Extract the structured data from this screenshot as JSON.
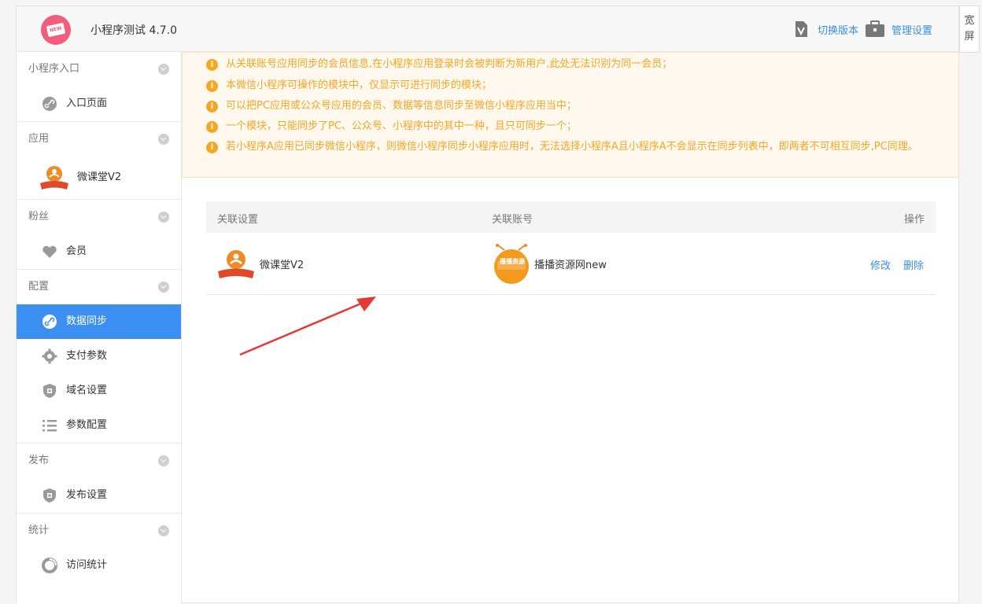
{
  "header": {
    "app_title": "小程序测试 4.7.0",
    "logo_text": "NEW",
    "switch_version": "切换版本",
    "manage_settings": "管理设置"
  },
  "side_tab": {
    "label": "宽屏"
  },
  "sidebar": {
    "groups": [
      {
        "title": "小程序入口",
        "items": [
          {
            "label": "入口页面",
            "icon": "link-icon"
          }
        ]
      },
      {
        "title": "应用",
        "items": [
          {
            "label": "微课堂V2",
            "icon": "app-logo"
          }
        ]
      },
      {
        "title": "粉丝",
        "items": [
          {
            "label": "会员",
            "icon": "heart-icon"
          }
        ]
      },
      {
        "title": "配置",
        "items": [
          {
            "label": "数据同步",
            "icon": "link-icon",
            "active": true
          },
          {
            "label": "支付参数",
            "icon": "gear-icon"
          },
          {
            "label": "域名设置",
            "icon": "shield-icon"
          },
          {
            "label": "参数配置",
            "icon": "list-icon"
          }
        ]
      },
      {
        "title": "发布",
        "items": [
          {
            "label": "发布设置",
            "icon": "shield-icon"
          }
        ]
      },
      {
        "title": "统计",
        "items": [
          {
            "label": "访问统计",
            "icon": "stats-icon"
          }
        ]
      }
    ]
  },
  "notice": {
    "lines": [
      "从关联账号应用同步的会员信息,在小程序应用登录时会被判断为新用户,此处无法识别为同一会员；",
      "本微信小程序可操作的模块中，仅显示可进行同步的模块；",
      "可以把PC应用或公众号应用的会员、数据等信息同步至微信小程序应用当中；",
      "一个模块，只能同步了PC、公众号、小程序中的其中一种，且只可同步一个；",
      "若小程序A应用已同步微信小程序，则微信小程序同步小程序应用时，无法选择小程序A且小程序A不会显示在同步列表中，即两者不可相互同步,PC同理。"
    ]
  },
  "table": {
    "headers": {
      "setting": "关联设置",
      "account": "关联账号",
      "action": "操作"
    },
    "rows": [
      {
        "setting": "微课堂V2",
        "account": "播播资源网new",
        "account_logo_text": "播播资源",
        "edit": "修改",
        "delete": "删除"
      }
    ]
  },
  "colors": {
    "accent": "#3b8ff0",
    "warning": "#f5a623",
    "link": "#3a8ee6"
  }
}
